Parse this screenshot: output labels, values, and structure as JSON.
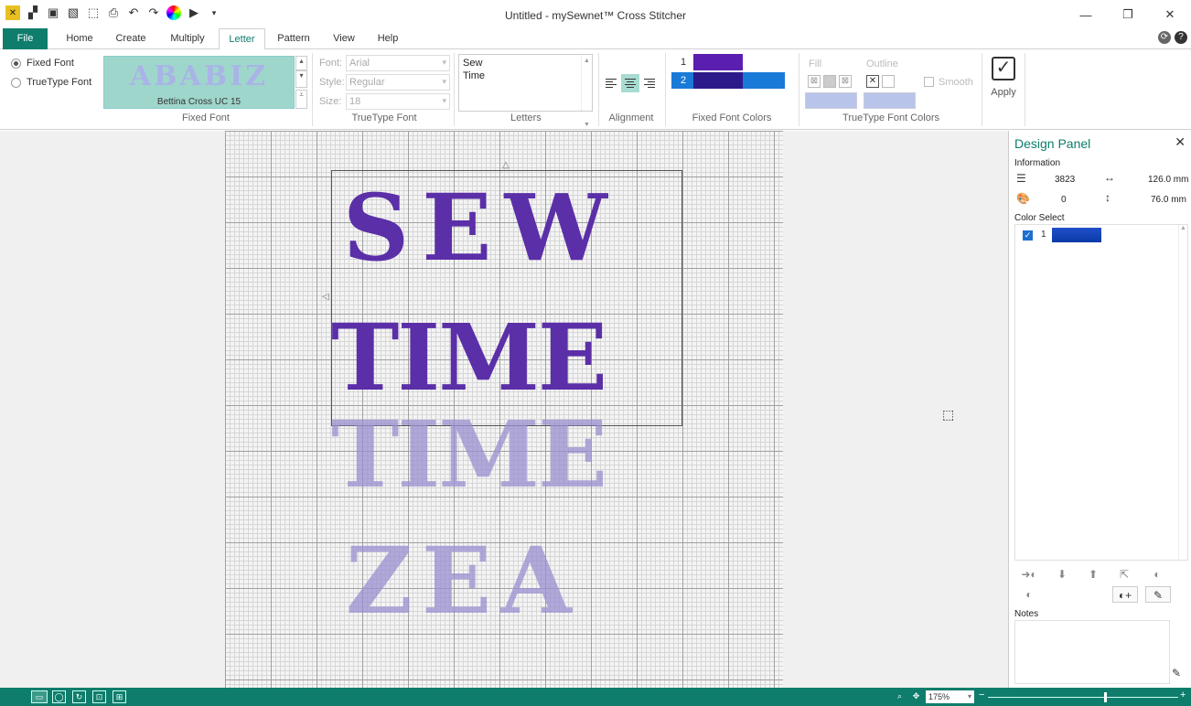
{
  "window": {
    "title": "Untitled - mySewnet™ Cross Stitcher"
  },
  "tabs": [
    "File",
    "Home",
    "Create",
    "Multiply",
    "Letter",
    "Pattern",
    "View",
    "Help"
  ],
  "ribbon": {
    "fixed_font_radio": "Fixed Font",
    "truetype_radio": "TrueType Font",
    "font_preview_text": "ABABIZ",
    "font_name": "Bettina Cross UC 15",
    "group_fixed_font": "Fixed Font",
    "tt_font_label": "Font:",
    "tt_font_value": "Arial",
    "tt_style_label": "Style:",
    "tt_style_value": "Regular",
    "tt_size_label": "Size:",
    "tt_size_value": "18",
    "group_truetype": "TrueType Font",
    "letters_lines": [
      "Sew",
      "Time"
    ],
    "group_letters": "Letters",
    "group_alignment": "Alignment",
    "ff_colors": [
      {
        "n": "1",
        "color": "#5a1fb0"
      },
      {
        "n": "2",
        "color": "#2c1a8a"
      }
    ],
    "group_ff_colors": "Fixed Font Colors",
    "fill_label": "Fill",
    "outline_label": "Outline",
    "smooth_label": "Smooth",
    "group_tt_colors": "TrueType Font Colors",
    "apply_label": "Apply"
  },
  "canvas": {
    "line1": "SEW",
    "line2": "TIME",
    "line3": "TIME",
    "line4": "ZEA"
  },
  "panel": {
    "title": "Design Panel",
    "information_label": "Information",
    "stitches": "3823",
    "width": "126.0 mm",
    "colors": "0",
    "height": "76.0 mm",
    "color_select_label": "Color Select",
    "color_rows": [
      {
        "n": "1",
        "checked": true,
        "color": "#1a4ec0"
      }
    ],
    "notes_label": "Notes"
  },
  "status": {
    "zoom": "175%"
  }
}
